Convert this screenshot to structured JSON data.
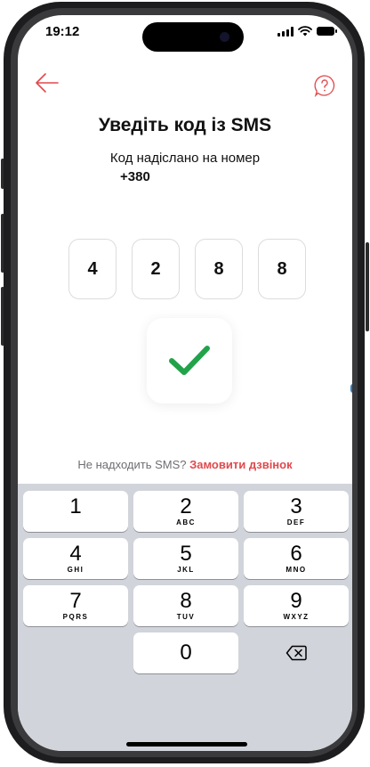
{
  "status_bar": {
    "time": "19:12"
  },
  "header": {
    "back_icon": "arrow-left-icon",
    "help_icon": "help-circle-icon"
  },
  "title": "Уведіть код із SMS",
  "subtitle": "Код надіслано на номер",
  "phone_number": "+380",
  "code_digits": [
    "4",
    "2",
    "8",
    "8"
  ],
  "success_icon": "checkmark-icon",
  "resend": {
    "prompt": "Не надходить SMS? ",
    "link": "Замовити дзвінок"
  },
  "keypad": {
    "keys": [
      {
        "num": "1",
        "letters": ""
      },
      {
        "num": "2",
        "letters": "ABC"
      },
      {
        "num": "3",
        "letters": "DEF"
      },
      {
        "num": "4",
        "letters": "GHI"
      },
      {
        "num": "5",
        "letters": "JKL"
      },
      {
        "num": "6",
        "letters": "MNO"
      },
      {
        "num": "7",
        "letters": "PQRS"
      },
      {
        "num": "8",
        "letters": "TUV"
      },
      {
        "num": "9",
        "letters": "WXYZ"
      },
      {
        "num": "0",
        "letters": ""
      }
    ],
    "delete_icon": "backspace-icon"
  },
  "colors": {
    "accent": "#e0494d",
    "check": "#22a34a",
    "keypad_bg": "#d1d4da"
  }
}
